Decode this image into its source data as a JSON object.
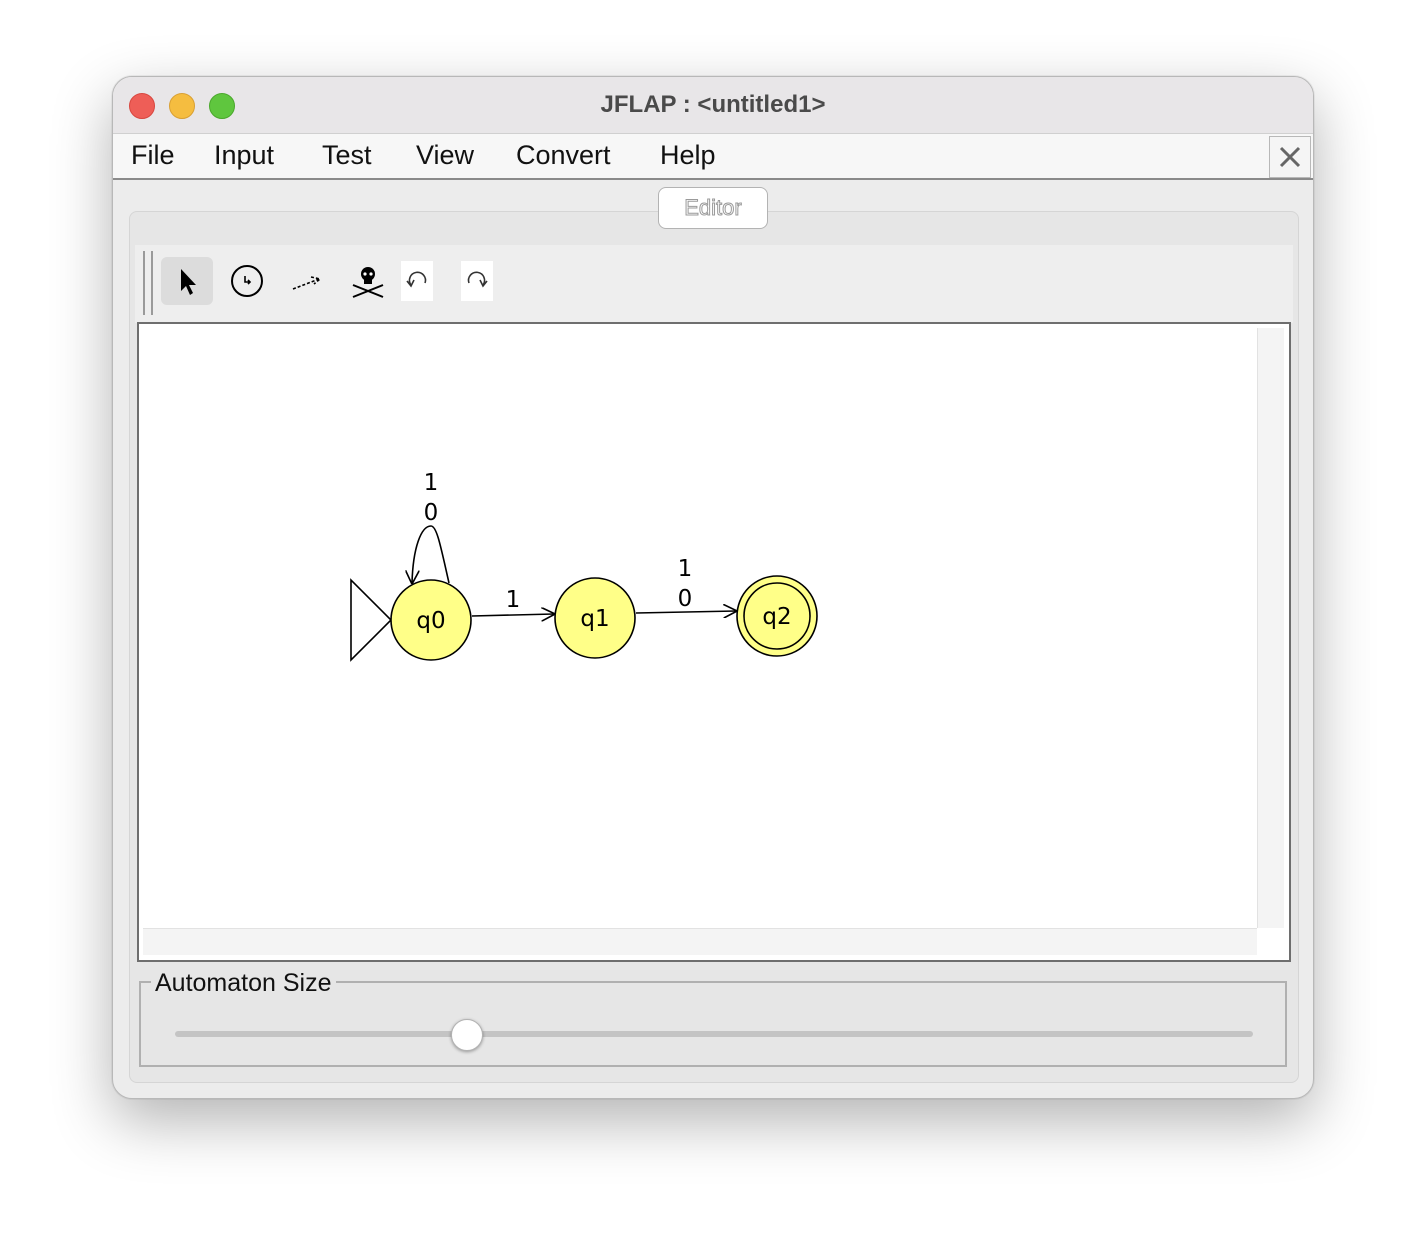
{
  "window": {
    "title": "JFLAP : <untitled1>"
  },
  "menubar": {
    "items": [
      "File",
      "Input",
      "Test",
      "View",
      "Convert",
      "Help"
    ]
  },
  "editor": {
    "tab_label": "Editor"
  },
  "toolbar": {
    "tools": [
      {
        "name": "attribute-editor",
        "icon": "arrow-pointer-icon",
        "selected": true
      },
      {
        "name": "state-creator",
        "icon": "state-circle-icon",
        "selected": false
      },
      {
        "name": "transition-creator",
        "icon": "transition-arrow-icon",
        "selected": false
      },
      {
        "name": "deleter",
        "icon": "skull-crossbones-icon",
        "selected": false
      },
      {
        "name": "undo",
        "icon": "undo-icon",
        "selected": false
      },
      {
        "name": "redo",
        "icon": "redo-icon",
        "selected": false
      }
    ]
  },
  "automaton": {
    "state_fill": "#ffff88",
    "states": [
      {
        "id": "q0",
        "label": "q0",
        "initial": true,
        "final": false
      },
      {
        "id": "q1",
        "label": "q1",
        "initial": false,
        "final": false
      },
      {
        "id": "q2",
        "label": "q2",
        "initial": false,
        "final": true
      }
    ],
    "transitions": [
      {
        "from": "q0",
        "to": "q0",
        "labels": [
          "1",
          "0"
        ]
      },
      {
        "from": "q0",
        "to": "q1",
        "labels": [
          "1"
        ]
      },
      {
        "from": "q1",
        "to": "q2",
        "labels": [
          "1",
          "0"
        ]
      }
    ]
  },
  "automaton_size": {
    "label": "Automaton Size",
    "value": 0.27
  }
}
